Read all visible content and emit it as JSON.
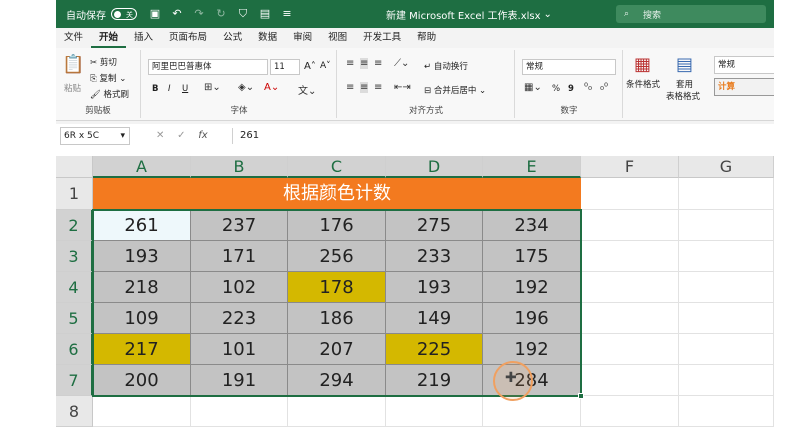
{
  "titlebar": {
    "autosave_label": "自动保存",
    "autosave_state": "关",
    "filename": "新建 Microsoft Excel 工作表.xlsx",
    "search_placeholder": "搜索"
  },
  "menu": {
    "tabs": [
      "文件",
      "开始",
      "插入",
      "页面布局",
      "公式",
      "数据",
      "审阅",
      "视图",
      "开发工具",
      "帮助"
    ],
    "active_index": 1
  },
  "ribbon": {
    "clipboard": {
      "paste": "粘贴",
      "cut": "剪切",
      "copy": "复制",
      "format_painter": "格式刷",
      "label": "剪贴板"
    },
    "font": {
      "name": "阿里巴巴普惠体",
      "size": "11",
      "grow": "A˄",
      "shrink": "A˅",
      "bold": "B",
      "italic": "I",
      "underline": "U",
      "label": "字体"
    },
    "alignment": {
      "wrap": "自动换行",
      "merge": "合并后居中",
      "label": "对齐方式"
    },
    "number": {
      "format": "常规",
      "percent": "%",
      "comma": "9",
      "label": "数字"
    },
    "styles": {
      "conditional": "条件格式",
      "table_format_line1": "套用",
      "table_format_line2": "表格格式",
      "style_normal": "常规",
      "style_calc": "计算"
    }
  },
  "formula_bar": {
    "name_box": "6R x 5C",
    "fx": "fx",
    "value": "261"
  },
  "sheet": {
    "columns": [
      "A",
      "B",
      "C",
      "D",
      "E",
      "F",
      "G"
    ],
    "rows": [
      "1",
      "2",
      "3",
      "4",
      "5",
      "6",
      "7",
      "8"
    ],
    "title": "根据颜色计数",
    "data": [
      [
        "261",
        "237",
        "176",
        "275",
        "234"
      ],
      [
        "193",
        "171",
        "256",
        "233",
        "175"
      ],
      [
        "218",
        "102",
        "178",
        "193",
        "192"
      ],
      [
        "109",
        "223",
        "186",
        "149",
        "196"
      ],
      [
        "217",
        "101",
        "207",
        "225",
        "192"
      ],
      [
        "200",
        "191",
        "294",
        "219",
        "284"
      ]
    ],
    "highlighted": [
      [
        2,
        2
      ],
      [
        4,
        0
      ],
      [
        4,
        3
      ]
    ],
    "active_cell": [
      0,
      0
    ],
    "colors": {
      "title_bg": "#f37a1f",
      "highlight": "#d4b800",
      "cell_gray": "#c3c3c3",
      "accent": "#1e6e42"
    }
  }
}
